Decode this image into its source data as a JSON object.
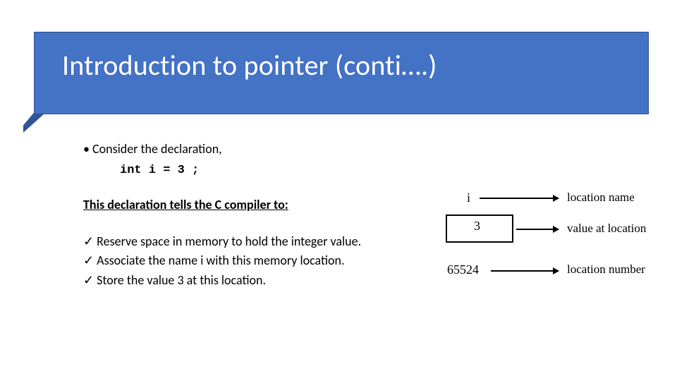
{
  "title": "Introduction to pointer (conti….)",
  "body": {
    "consider": "Consider the declaration,",
    "code": "int i = 3 ;",
    "subhead": "This declaration tells the C compiler to:",
    "checks": [
      "Reserve space in memory to hold the integer value.",
      "Associate the name i with this memory location.",
      "Store the value 3 at this location."
    ]
  },
  "diagram": {
    "var_name": "i",
    "value": "3",
    "address": "65524",
    "label_name": "location name",
    "label_value": "value at location",
    "label_addr": "location number"
  }
}
